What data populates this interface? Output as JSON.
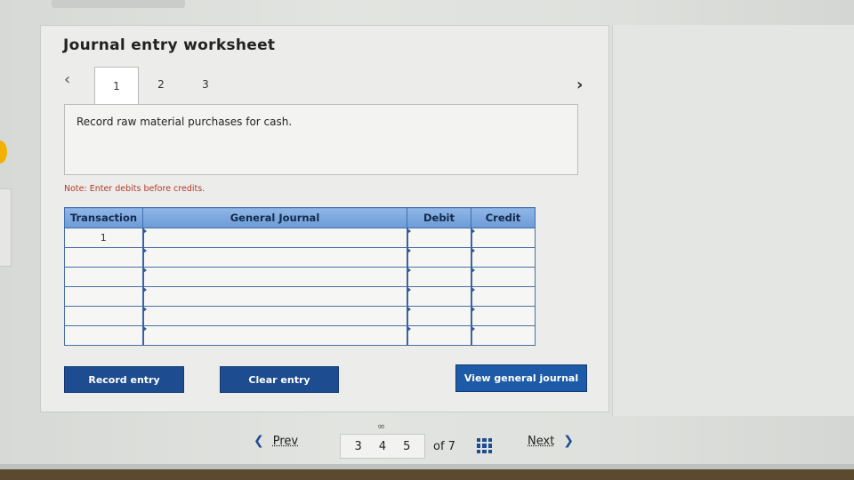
{
  "worksheet": {
    "title": "Journal entry worksheet",
    "tabs": [
      {
        "label": "1"
      },
      {
        "label": "2"
      },
      {
        "label": "3"
      }
    ],
    "description": "Record raw material purchases for cash.",
    "note": "Note: Enter debits before credits."
  },
  "table": {
    "headers": [
      "Transaction",
      "General Journal",
      "Debit",
      "Credit"
    ],
    "rows": [
      {
        "transaction": "1"
      },
      {
        "transaction": ""
      },
      {
        "transaction": ""
      },
      {
        "transaction": ""
      },
      {
        "transaction": ""
      },
      {
        "transaction": ""
      }
    ]
  },
  "buttons": {
    "record": "Record entry",
    "clear": "Clear entry",
    "view": "View general journal"
  },
  "pagination": {
    "prev": "Prev",
    "pages": [
      "3",
      "4",
      "5"
    ],
    "current": "4",
    "of": "of 7",
    "next": "Next"
  },
  "icons": {
    "prev_tab": "chevron-left-icon",
    "next_tab": "chevron-right-icon",
    "link": "link-icon",
    "grid": "grid-icon"
  },
  "colors": {
    "accent": "#1d4c91",
    "header": "#7ea8dd",
    "note": "#b53a2a"
  }
}
